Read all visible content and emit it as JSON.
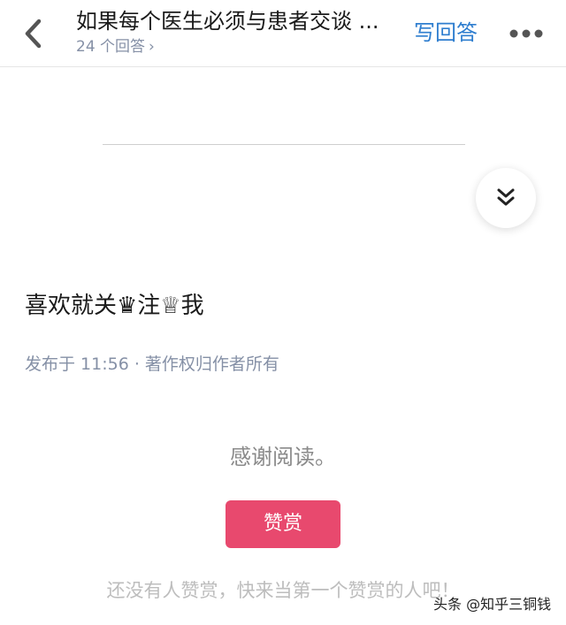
{
  "header": {
    "title": "如果每个医生必须与患者交谈 ...",
    "answers_count": "24 个回答",
    "write_answer": "写回答"
  },
  "icons": {
    "back": "chevron-left-icon",
    "more": "more-dots-icon",
    "collapse": "double-chevron-down-icon",
    "answers_chevron": "chevron-right-icon"
  },
  "content": {
    "body": "喜欢就关♛注♕我",
    "meta": "发布于 11:56 · 著作权归作者所有"
  },
  "reward": {
    "thanks": "感谢阅读。",
    "button": "赞赏",
    "empty": "还没有人赞赏，快来当第一个赞赏的人吧！"
  },
  "watermark": "头条 @知乎三铜钱",
  "colors": {
    "accent_blue": "#2f7ecf",
    "reward_pink": "#e8496e",
    "muted_gray": "#8590a6"
  }
}
